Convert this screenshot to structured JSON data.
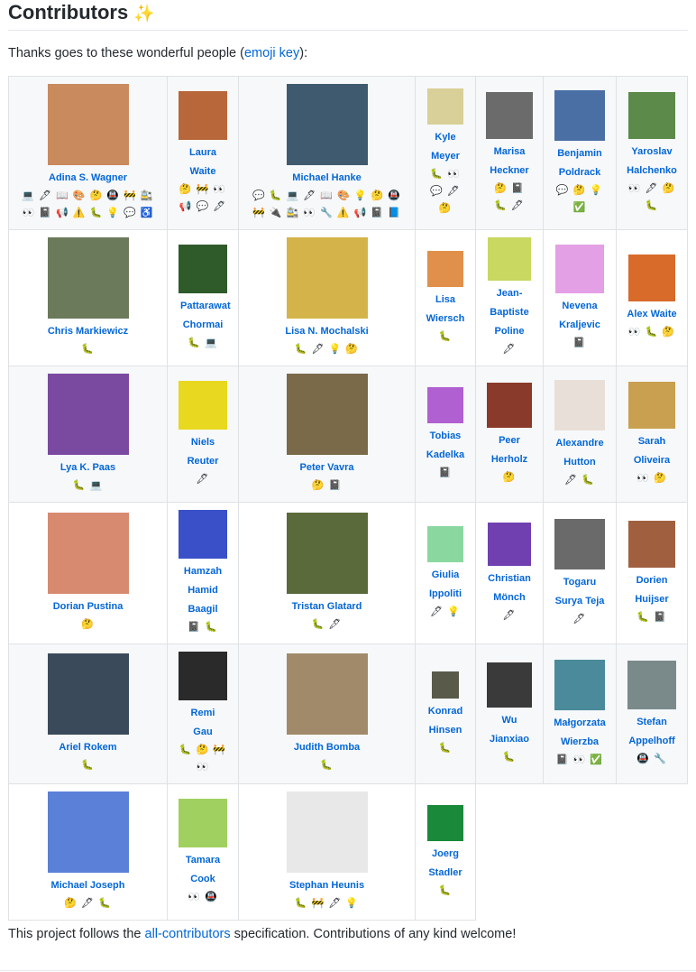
{
  "heading": {
    "title": "Contributors",
    "sparkle": "✨"
  },
  "intro": {
    "before": "Thanks goes to these wonderful people (",
    "link": "emoji key",
    "after": "):"
  },
  "outro": {
    "before": "This project follows the ",
    "link": "all-contributors",
    "after": " specification. Contributions of any kind welcome!"
  },
  "rows": [
    [
      {
        "name": "Adina S. Wagner",
        "emoji": [
          "💻 🖋 📖 🎨 🤔 🚇 🚧 🚉",
          "👀 📓 📢 ⚠️ 🐛 💡 💬 ♿️"
        ],
        "av": "#c98a5e"
      },
      {
        "name": "Laura Waite",
        "emoji": [
          "🤔 🚧 👀",
          "📢 💬 🖋"
        ],
        "av": "#b8673a"
      },
      {
        "name": "Michael Hanke",
        "emoji": [
          "💬 🐛 💻 🖋 📖 🎨 💡 🤔 🚇",
          "🚧 🔌 🚉 👀 🔧 ⚠️ 📢 📓 📘"
        ],
        "av": "#3f5a6e"
      },
      {
        "name": "Kyle Meyer",
        "emoji": [
          "🐛 👀",
          "💬 🖋",
          "🤔"
        ],
        "av": "#d8d098"
      },
      {
        "name": "Marisa Heckner",
        "emoji": [
          "🤔 📓",
          "🐛 🖋"
        ],
        "av": "#6b6b6b"
      },
      {
        "name": "Benjamin Poldrack",
        "emoji": [
          "💬 🤔 💡",
          "✅"
        ],
        "av": "#4a6fa5"
      },
      {
        "name": "Yaroslav Halchenko",
        "emoji": [
          "👀 🖋 🤔",
          "🐛"
        ],
        "av": "#5c8a4a"
      }
    ],
    [
      {
        "name": "Chris Markiewicz",
        "emoji": [
          "🐛"
        ],
        "av": "#6b7a5a"
      },
      {
        "name": "Pattarawat Chormai",
        "emoji": [
          "🐛 💻"
        ],
        "av": "#2f5a2a"
      },
      {
        "name": "Lisa N. Mochalski",
        "emoji": [
          "🐛 🖋 💡 🤔"
        ],
        "av": "#d4b44a"
      },
      {
        "name": "Lisa Wiersch",
        "emoji": [
          "🐛"
        ],
        "av": "#e0904a"
      },
      {
        "name": "Jean-Baptiste Poline",
        "emoji": [
          "🖋"
        ],
        "av": "#c8d860"
      },
      {
        "name": "Nevena Kraljevic",
        "emoji": [
          "📓"
        ],
        "av": "#e4a0e4"
      },
      {
        "name": "Alex Waite",
        "emoji": [
          "👀 🐛 🤔"
        ],
        "av": "#d86a2a"
      }
    ],
    [
      {
        "name": "Lya K. Paas",
        "emoji": [
          "🐛 💻"
        ],
        "av": "#7a4aa0"
      },
      {
        "name": "Niels Reuter",
        "emoji": [
          "🖋"
        ],
        "av": "#e8d820"
      },
      {
        "name": "Peter Vavra",
        "emoji": [
          "🤔 📓"
        ],
        "av": "#7a6a4a"
      },
      {
        "name": "Tobias Kadelka",
        "emoji": [
          "📓"
        ],
        "av": "#b060d0"
      },
      {
        "name": "Peer Herholz",
        "emoji": [
          "🤔"
        ],
        "av": "#8a3a2a"
      },
      {
        "name": "Alexandre Hutton",
        "emoji": [
          "🖋 🐛"
        ],
        "av": "#e8e0d8"
      },
      {
        "name": "Sarah Oliveira",
        "emoji": [
          "👀 🤔"
        ],
        "av": "#c8a050"
      }
    ],
    [
      {
        "name": "Dorian Pustina",
        "emoji": [
          "🤔"
        ],
        "av": "#d88a70"
      },
      {
        "name": "Hamzah Hamid Baagil",
        "emoji": [
          "📓 🐛"
        ],
        "av": "#3a50c8"
      },
      {
        "name": "Tristan Glatard",
        "emoji": [
          "🐛 🖋"
        ],
        "av": "#5a6a3a"
      },
      {
        "name": "Giulia Ippoliti",
        "emoji": [
          "🖋 💡"
        ],
        "av": "#8ad8a0"
      },
      {
        "name": "Christian Mönch",
        "emoji": [
          "🖋"
        ],
        "av": "#7040b0"
      },
      {
        "name": "Togaru Surya Teja",
        "emoji": [
          "🖋"
        ],
        "av": "#6a6a6a"
      },
      {
        "name": "Dorien Huijser",
        "emoji": [
          "🐛 📓"
        ],
        "av": "#a06040"
      }
    ],
    [
      {
        "name": "Ariel Rokem",
        "emoji": [
          "🐛"
        ],
        "av": "#3a4a5a"
      },
      {
        "name": "Remi Gau",
        "emoji": [
          "🐛 🤔 🚧",
          "👀"
        ],
        "av": "#2a2a2a"
      },
      {
        "name": "Judith Bomba",
        "emoji": [
          "🐛"
        ],
        "av": "#a08a6a"
      },
      {
        "name": "Konrad Hinsen",
        "emoji": [
          "🐛"
        ],
        "av": "#5a5a4a"
      },
      {
        "name": "Wu Jianxiao",
        "emoji": [
          "🐛"
        ],
        "av": "#3a3a3a"
      },
      {
        "name": "Małgorzata Wierzba",
        "emoji": [
          "📓 👀 ✅"
        ],
        "av": "#4a8a9a"
      },
      {
        "name": "Stefan Appelhoff",
        "emoji": [
          "🚇 🔧"
        ],
        "av": "#7a8a8a"
      }
    ],
    [
      {
        "name": "Michael Joseph",
        "emoji": [
          "🤔 🖋 🐛"
        ],
        "av": "#5a80d8"
      },
      {
        "name": "Tamara Cook",
        "emoji": [
          "👀 🚇"
        ],
        "av": "#a0d060"
      },
      {
        "name": "Stephan Heunis",
        "emoji": [
          "🐛 🚧 🖋 💡"
        ],
        "av": "#e8e8e8"
      },
      {
        "name": "Joerg Stadler",
        "emoji": [
          "🐛"
        ],
        "av": "#1a8a3a"
      }
    ]
  ]
}
